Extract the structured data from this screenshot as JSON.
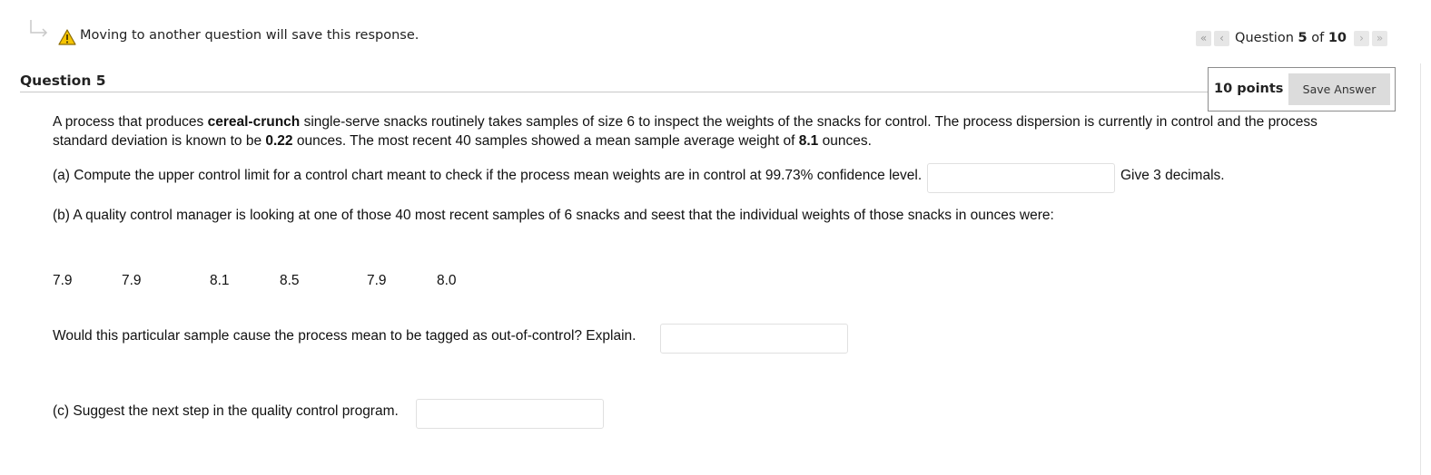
{
  "header": {
    "warning_text": "Moving to another question will save this response.",
    "pager": {
      "prefix": "Question",
      "current": "5",
      "of_word": "of",
      "total": "10",
      "first_icon": "double-chevron-left-icon",
      "prev_icon": "chevron-left-icon",
      "next_icon": "chevron-right-icon",
      "last_icon": "double-chevron-right-icon"
    }
  },
  "question": {
    "title": "Question 5",
    "points": "10 points",
    "save_label": "Save Answer",
    "intro": {
      "part1": "A process that produces ",
      "product": "cereal-crunch",
      "part2": " single-serve snacks routinely takes samples of size 6 to inspect the weights of the snacks for control.  The process dispersion is currently in control and the process standard deviation is known to be ",
      "sigma": "0.22",
      "part3": " ounces.   The most recent 40 samples showed a mean sample average weight of ",
      "mean": "8.1",
      "part4": " ounces."
    },
    "part_a": "(a) Compute the upper control limit for a control chart meant to check if the process mean weights are in control at 99.73% confidence level.",
    "part_a_answer": "",
    "part_a_hint": "Give 3 decimals.",
    "part_b": "(b)  A quality control manager is looking at one of those 40 most recent samples of 6 snacks and seest that the individual weights of those snacks in ounces were:",
    "weights": [
      "7.9",
      "7.9",
      "8.1",
      "8.5",
      "7.9",
      "8.0"
    ],
    "explain_prompt": "Would this particular sample cause the process mean to be tagged as out-of-control?  Explain.",
    "explain_answer": "",
    "part_c": "(c) Suggest the next step in the quality control program.",
    "part_c_answer": ""
  },
  "colors": {
    "warning": "#f5c400",
    "nav_button": "#e6e6e6",
    "save_button": "#dcdcdc"
  }
}
